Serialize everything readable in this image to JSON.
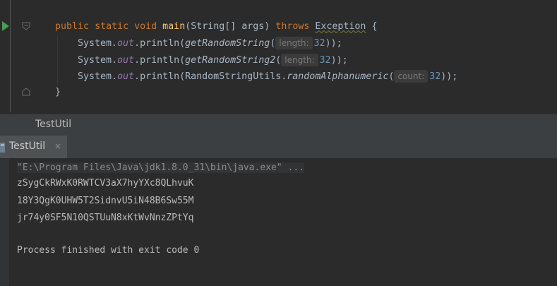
{
  "editor": {
    "line1": {
      "kw_public": "public",
      "kw_static": "static",
      "kw_void": "void",
      "method": "main",
      "params": "(String[] args)",
      "kw_throws": "throws",
      "exception": "Exception",
      "brace": "{"
    },
    "line2": {
      "prefix": "System.",
      "field": "out",
      "call": ".println(",
      "method": "getRandomString",
      "open": "(",
      "hint": "length:",
      "num": "32",
      "close": "));"
    },
    "line3": {
      "prefix": "System.",
      "field": "out",
      "call": ".println(",
      "method": "getRandomString2",
      "open": "(",
      "hint": "length:",
      "num": "32",
      "close": "));"
    },
    "line4": {
      "prefix": "System.",
      "field": "out",
      "call": ".println(RandomStringUtils.",
      "method": "randomAlphanumeric",
      "open": "(",
      "hint": "count:",
      "num": "32",
      "close": "));"
    },
    "line5": {
      "brace": "}"
    }
  },
  "toolbar": {
    "title": "TestUtil"
  },
  "run_tab": {
    "label": "TestUtil",
    "close": "×"
  },
  "console": {
    "command": "\"E:\\Program Files\\Java\\jdk1.8.0_31\\bin\\java.exe\" ...",
    "lines": [
      "zSygCkRWxK0RWTCV3aX7hyYXc8QLhvuK",
      "18Y3QgK0UHW5T2SidnvU5iN48B6Sw55M",
      "jr74y0SF5N10QSTUuN8xKtWvNnzZPtYq"
    ],
    "exit": "Process finished with exit code 0"
  },
  "colors": {
    "background": "#2b2b2b",
    "keyword": "#cc7832",
    "method": "#ffc66d",
    "field": "#9876aa",
    "number": "#6897bb",
    "run": "#499c54"
  }
}
